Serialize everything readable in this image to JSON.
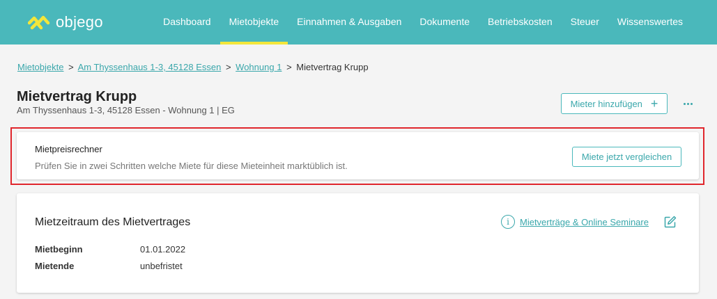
{
  "brand": {
    "name": "objego",
    "accent": "#4ab8bb",
    "highlight": "#f3e63b"
  },
  "nav": {
    "items": [
      {
        "label": "Dashboard",
        "active": false
      },
      {
        "label": "Mietobjekte",
        "active": true
      },
      {
        "label": "Einnahmen & Ausgaben",
        "active": false
      },
      {
        "label": "Dokumente",
        "active": false
      },
      {
        "label": "Betriebskosten",
        "active": false
      },
      {
        "label": "Steuer",
        "active": false
      },
      {
        "label": "Wissenswertes",
        "active": false
      }
    ]
  },
  "breadcrumb": {
    "items": [
      "Mietobjekte",
      " Am Thyssenhaus 1-3, 45128 Essen",
      "Wohnung 1"
    ],
    "separator": ">",
    "current": "Mietvertrag Krupp"
  },
  "page": {
    "title": "Mietvertrag Krupp",
    "subtitle": "Am Thyssenhaus 1-3, 45128 Essen - Wohnung 1 | EG",
    "add_tenant_label": "Mieter hinzufügen",
    "add_icon": "+",
    "more_icon": "more-dots-icon"
  },
  "calculator": {
    "title": "Mietpreisrechner",
    "description": "Prüfen Sie in zwei Schritten welche Miete für diese Mieteinheit marktüblich ist.",
    "button_label": "Miete jetzt vergleichen",
    "highlight_color": "#e0262c"
  },
  "rental_period": {
    "title": "Mietzeitraum des Mietvertrages",
    "info_icon": "i",
    "link_label": "Mietverträge & Online Seminare",
    "edit_icon": "pencil-icon",
    "rows": [
      {
        "label": "Mietbeginn",
        "value": "01.01.2022"
      },
      {
        "label": "Mietende",
        "value": "unbefristet"
      }
    ]
  }
}
